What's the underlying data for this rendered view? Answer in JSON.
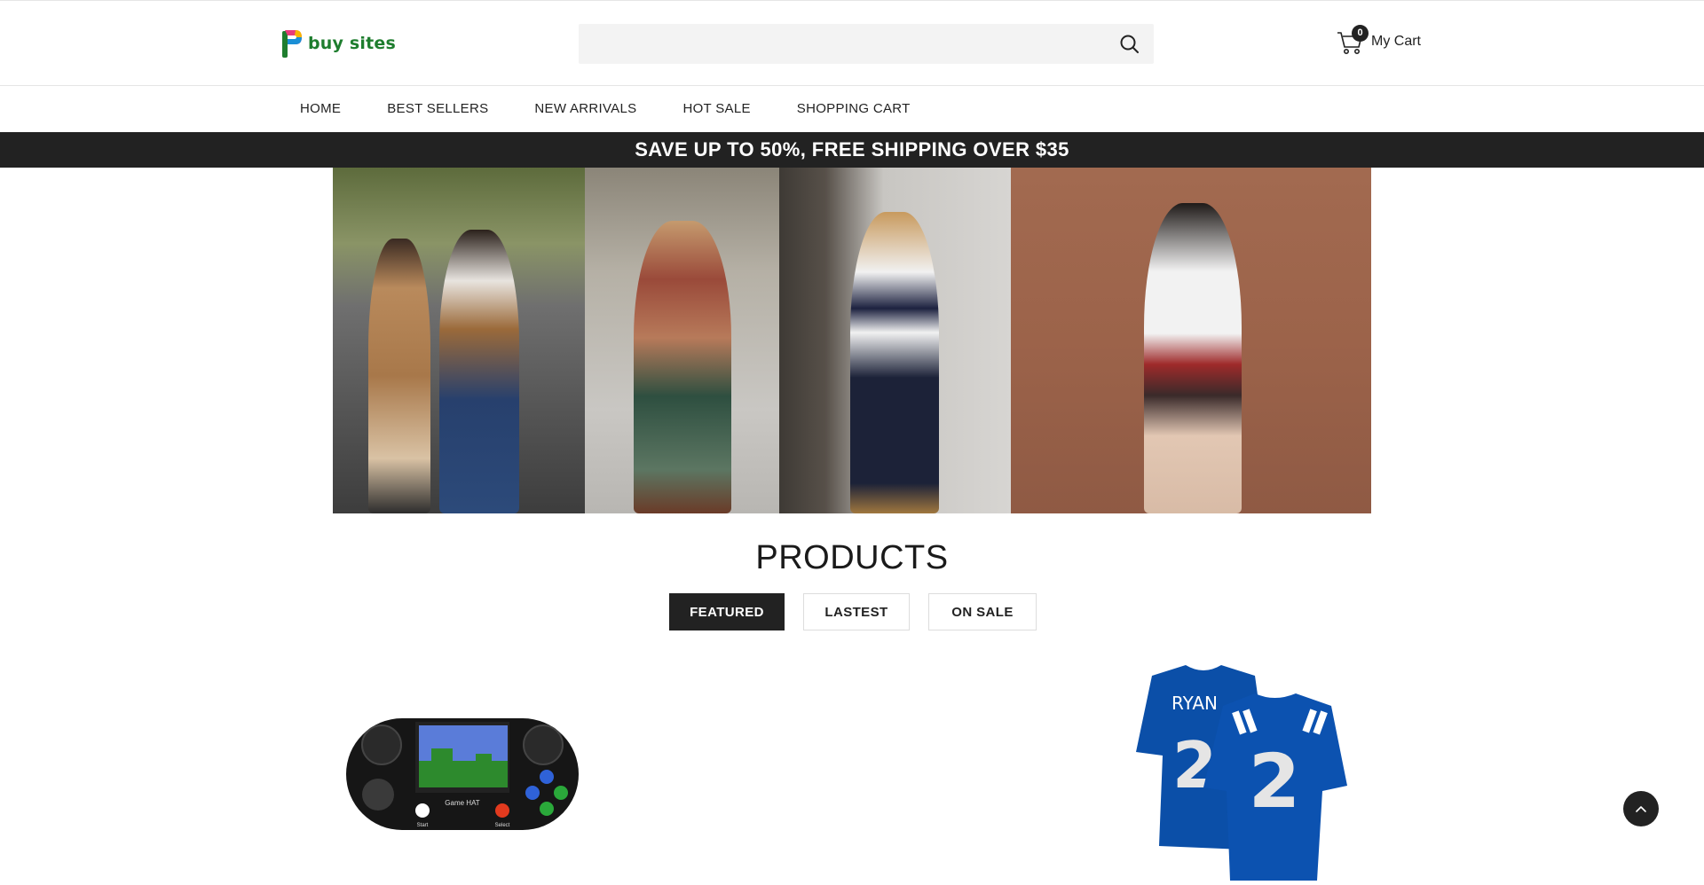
{
  "header": {
    "logo_text": "buy sites",
    "search": {
      "value": "",
      "placeholder": ""
    },
    "cart": {
      "count": "0",
      "label": "My Cart"
    }
  },
  "nav": {
    "items": [
      "HOME",
      "BEST SELLERS",
      "NEW ARRIVALS",
      "HOT SALE",
      "SHOPPING CART"
    ]
  },
  "promo": {
    "text": "SAVE UP TO 50%, FREE SHIPPING OVER $35"
  },
  "products": {
    "title": "PRODUCTS",
    "tabs": [
      {
        "label": "FEATURED",
        "active": true
      },
      {
        "label": "LASTEST",
        "active": false
      },
      {
        "label": "ON SALE",
        "active": false
      }
    ],
    "items": [
      {
        "screen_text": "Game HAT",
        "button_labels": [
          "Start",
          "Select"
        ]
      },
      {
        "jersey_name": "RYAN",
        "jersey_number": "2"
      }
    ]
  },
  "colors": {
    "accent": "#222222",
    "logo_green": "#1e7d2e",
    "search_bg": "#f3f3f3",
    "jersey_blue": "#0b4fa8"
  }
}
